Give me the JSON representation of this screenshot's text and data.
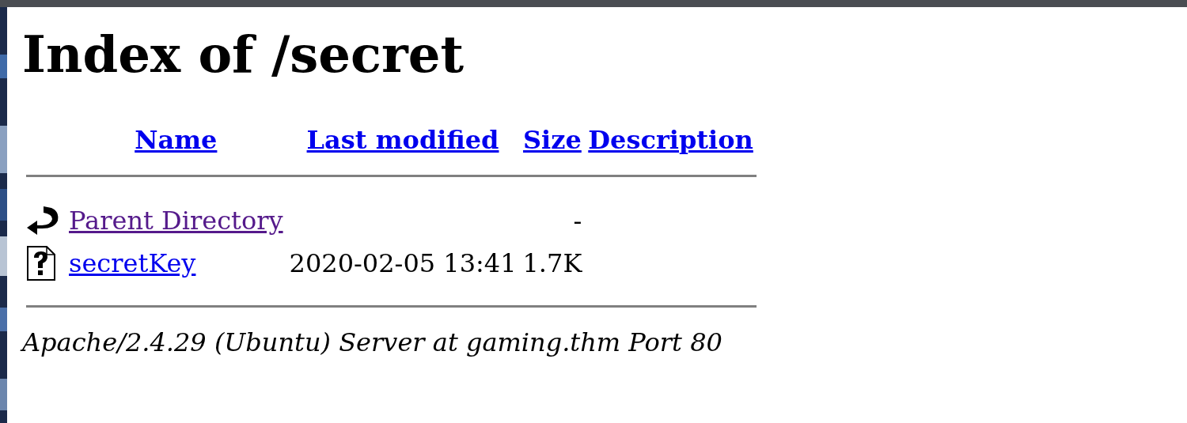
{
  "title": "Index of /secret",
  "table": {
    "columns": [
      "Name",
      "Last modified",
      "Size",
      "Description"
    ],
    "rows": [
      {
        "kind": "parent",
        "name": "Parent Directory",
        "visited": true,
        "last_modified": "",
        "size": "-"
      },
      {
        "kind": "file",
        "name": "secretKey",
        "visited": false,
        "last_modified": "2020-02-05 13:41",
        "size": "1.7K"
      }
    ]
  },
  "footer": "Apache/2.4.29 (Ubuntu) Server at gaming.thm Port 80"
}
